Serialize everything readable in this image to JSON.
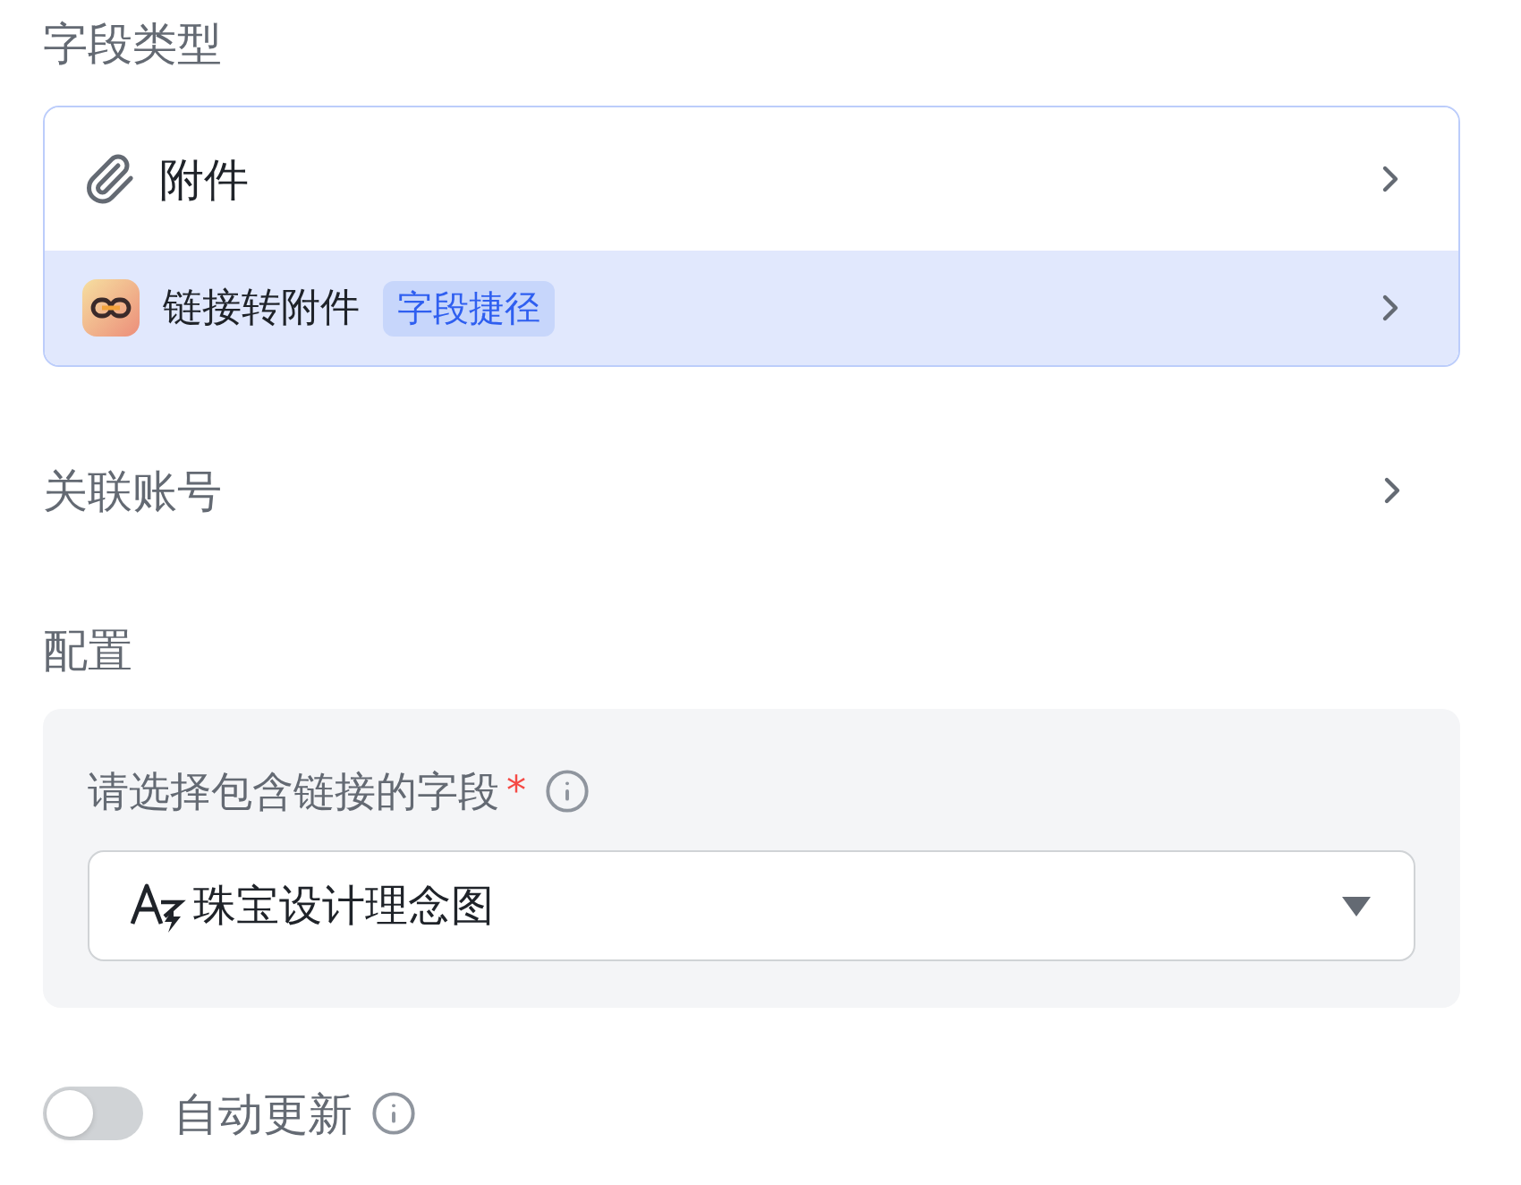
{
  "field_type": {
    "label": "字段类型",
    "options": [
      {
        "kind": "type",
        "label": "附件",
        "selected": false
      },
      {
        "kind": "shortcut",
        "label": "链接转附件",
        "badge": "字段捷径",
        "selected": true
      }
    ]
  },
  "linked_account": {
    "label": "关联账号"
  },
  "config": {
    "label": "配置",
    "field": {
      "label": "请选择包含链接的字段",
      "required_mark": "*",
      "value": "珠宝设计理念图"
    }
  },
  "auto_update": {
    "label": "自动更新",
    "on": false
  }
}
